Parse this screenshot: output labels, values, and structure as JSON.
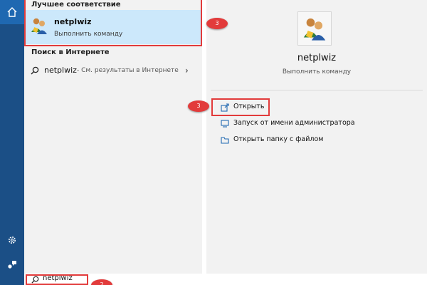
{
  "best_match": {
    "heading": "Лучшее соответствие",
    "title": "netplwiz",
    "subtitle": "Выполнить команду"
  },
  "web_search": {
    "heading": "Поиск в Интернете",
    "query": "netplwiz",
    "hint": "- См. результаты в Интернете"
  },
  "preview": {
    "title": "netplwiz",
    "subtitle": "Выполнить команду",
    "actions": [
      {
        "label": "Открыть",
        "icon": "open-icon"
      },
      {
        "label": "Запуск от имени администратора",
        "icon": "shield-icon"
      },
      {
        "label": "Открыть папку с файлом",
        "icon": "folder-icon"
      }
    ]
  },
  "search_box": {
    "value": "netplwiz"
  },
  "annotations": {
    "badge_best": "3",
    "badge_open": "3",
    "badge_search": "2"
  },
  "colors": {
    "rail": "#1b4f86",
    "highlight": "#cce8fb",
    "annotation": "#e23b3b",
    "accent_icon": "#1f68b1"
  }
}
